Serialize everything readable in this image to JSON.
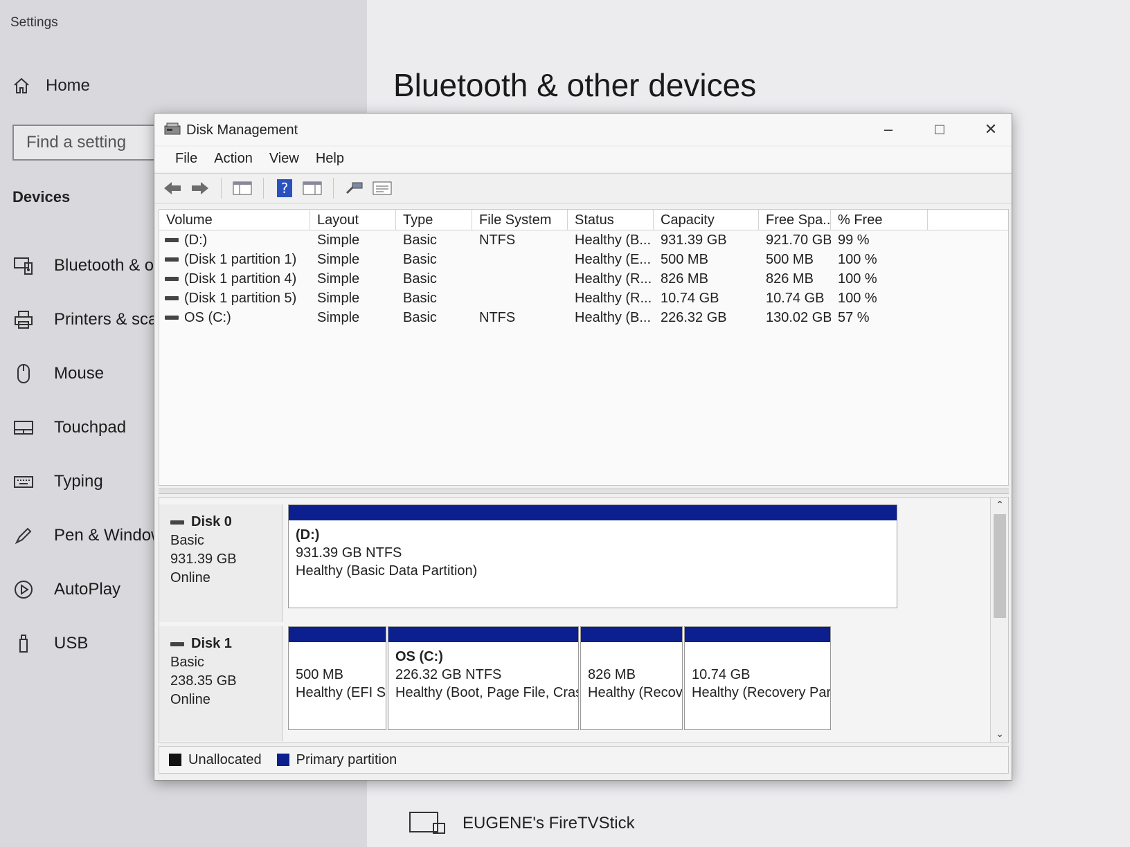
{
  "settings": {
    "title": "Settings",
    "home_label": "Home",
    "search_placeholder": "Find a setting",
    "section_heading": "Devices",
    "nav_items": [
      {
        "label": "Bluetooth & other devices",
        "icon": "bluetooth-devices-icon"
      },
      {
        "label": "Printers & scanners",
        "icon": "printer-icon"
      },
      {
        "label": "Mouse",
        "icon": "mouse-icon"
      },
      {
        "label": "Touchpad",
        "icon": "touchpad-icon"
      },
      {
        "label": "Typing",
        "icon": "keyboard-icon"
      },
      {
        "label": "Pen & Windows Ink",
        "icon": "pen-icon"
      },
      {
        "label": "AutoPlay",
        "icon": "autoplay-icon"
      },
      {
        "label": "USB",
        "icon": "usb-icon"
      }
    ],
    "page_heading": "Bluetooth & other devices",
    "device_name": "EUGENE's FireTVStick"
  },
  "disk_management": {
    "title": "Disk Management",
    "menu": [
      "File",
      "Action",
      "View",
      "Help"
    ],
    "toolbar_icons": [
      "back-arrow-icon",
      "forward-arrow-icon",
      "console-tree-icon",
      "help-icon",
      "action-pane-icon",
      "connect-icon",
      "properties-icon"
    ],
    "columns": [
      "Volume",
      "Layout",
      "Type",
      "File System",
      "Status",
      "Capacity",
      "Free Spa...",
      "% Free"
    ],
    "volumes": [
      {
        "volume": "(D:)",
        "layout": "Simple",
        "type": "Basic",
        "fs": "NTFS",
        "status": "Healthy (B...",
        "capacity": "931.39 GB",
        "free": "921.70 GB",
        "pct": "99 %"
      },
      {
        "volume": "(Disk 1 partition 1)",
        "layout": "Simple",
        "type": "Basic",
        "fs": "",
        "status": "Healthy (E...",
        "capacity": "500 MB",
        "free": "500 MB",
        "pct": "100 %"
      },
      {
        "volume": "(Disk 1 partition 4)",
        "layout": "Simple",
        "type": "Basic",
        "fs": "",
        "status": "Healthy (R...",
        "capacity": "826 MB",
        "free": "826 MB",
        "pct": "100 %"
      },
      {
        "volume": "(Disk 1 partition 5)",
        "layout": "Simple",
        "type": "Basic",
        "fs": "",
        "status": "Healthy (R...",
        "capacity": "10.74 GB",
        "free": "10.74 GB",
        "pct": "100 %"
      },
      {
        "volume": "OS (C:)",
        "layout": "Simple",
        "type": "Basic",
        "fs": "NTFS",
        "status": "Healthy (B...",
        "capacity": "226.32 GB",
        "free": "130.02 GB",
        "pct": "57 %"
      }
    ],
    "disks": [
      {
        "name": "Disk 0",
        "type": "Basic",
        "size": "931.39 GB",
        "state": "Online",
        "partitions": [
          {
            "name": "(D:)",
            "size": "931.39 GB NTFS",
            "status": "Healthy (Basic Data Partition)"
          }
        ]
      },
      {
        "name": "Disk 1",
        "type": "Basic",
        "size": "238.35 GB",
        "state": "Online",
        "partitions": [
          {
            "name": "",
            "size": "500 MB",
            "status": "Healthy (EFI S"
          },
          {
            "name": "OS  (C:)",
            "size": "226.32 GB NTFS",
            "status": "Healthy (Boot, Page File, Crasl"
          },
          {
            "name": "",
            "size": "826 MB",
            "status": "Healthy (Recov"
          },
          {
            "name": "",
            "size": "10.74 GB",
            "status": "Healthy (Recovery Par"
          }
        ]
      }
    ],
    "legend": {
      "unallocated": "Unallocated",
      "primary": "Primary partition"
    },
    "colors": {
      "primary_partition": "#0b1f8f",
      "unallocated": "#111111"
    }
  }
}
